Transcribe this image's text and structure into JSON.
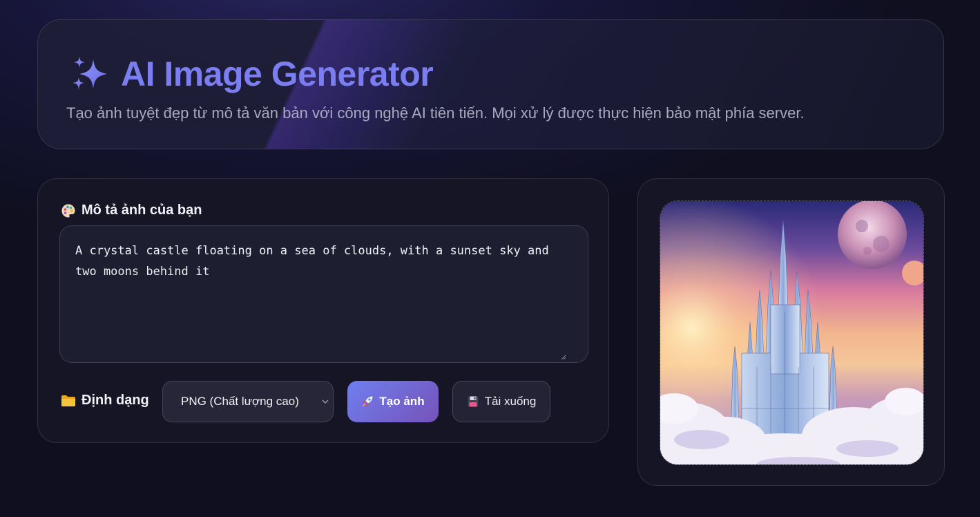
{
  "header": {
    "title": "AI Image Generator",
    "subtitle": "Tạo ảnh tuyệt đẹp từ mô tả văn bản với công nghệ AI tiên tiến. Mọi xử lý được thực hiện bảo mật phía server.",
    "icon": "sparkles-icon"
  },
  "prompt": {
    "label": "Mô tả ảnh của bạn",
    "icon": "palette-icon",
    "value": "A crystal castle floating on a sea of clouds, with a sunset sky and two moons behind it"
  },
  "format": {
    "label": "Định dạng",
    "icon": "folder-icon",
    "selected": "PNG (Chất lượng cao)"
  },
  "actions": {
    "generate_label": "Tạo ảnh",
    "generate_icon": "rocket-icon",
    "download_label": "Tải xuống",
    "download_icon": "floppy-disk-icon"
  },
  "result": {
    "image": "generated-castle-image"
  },
  "colors": {
    "accent": "#7b7ef0",
    "button_gradient_start": "#6f7ff0",
    "button_gradient_end": "#7652b8",
    "background": "#0f0f1f"
  }
}
